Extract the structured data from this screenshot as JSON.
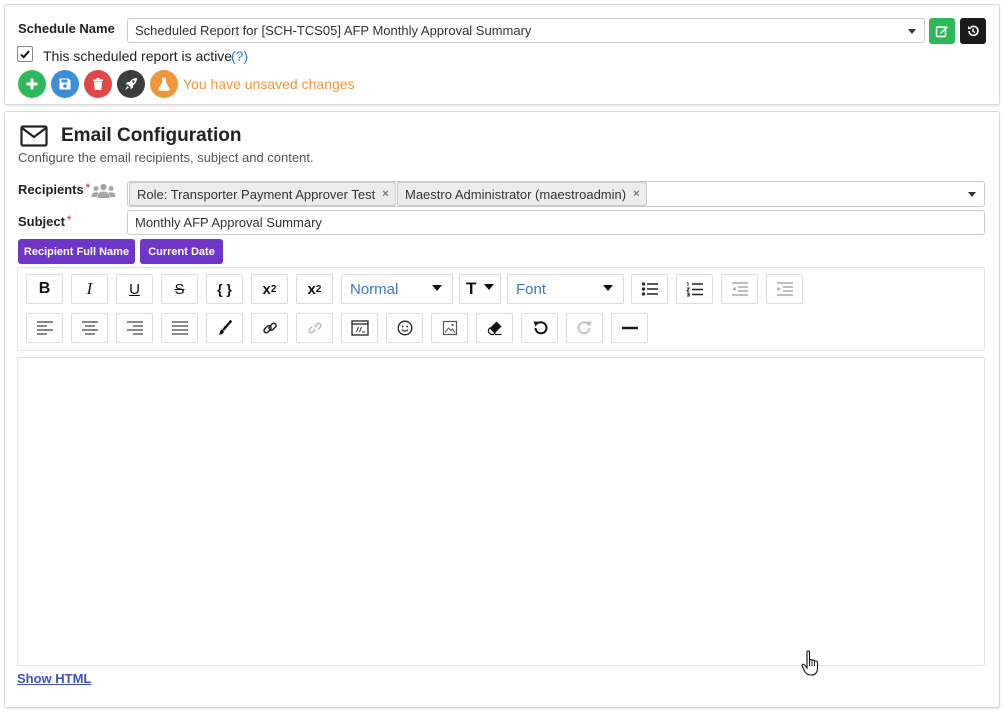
{
  "schedule": {
    "name_label": "Schedule Name",
    "name_value": "Scheduled Report for [SCH-TCS05] AFP Monthly Approval Summary",
    "active_label": "This scheduled report is active",
    "active_help": "(?)",
    "active_checked": true,
    "unsaved_message": "You have unsaved changes"
  },
  "email": {
    "title": "Email Configuration",
    "description": "Configure the email recipients, subject and content.",
    "recipients_label": "Recipients",
    "required_mark": "*",
    "recipients": [
      {
        "label": "Role: Transporter Payment Approver Test",
        "remove": "×"
      },
      {
        "label": "Maestro Administrator (maestroadmin)",
        "remove": "×"
      }
    ],
    "subject_label": "Subject",
    "subject_value": "Monthly AFP Approval Summary",
    "placeholders": [
      "Recipient Full Name",
      "Current Date"
    ],
    "show_html_link": "Show HTML"
  },
  "toolbar": {
    "bold": "B",
    "italic": "I",
    "underline": "U",
    "strikethrough": "S",
    "code": "{ }",
    "superscript_base": "x",
    "superscript_exp": "2",
    "subscript_base": "x",
    "subscript_exp": "2",
    "paragraph_format": "Normal",
    "font_size_icon": "T",
    "font_family": "Font"
  },
  "colors": {
    "green": "#2fb85a",
    "blue": "#3a8fd6",
    "red": "#e04848",
    "dark": "#3c3c3c",
    "orange": "#f0953a",
    "purple": "#6f35c9",
    "warning_text": "#f0953a"
  },
  "icons": [
    "edit-icon",
    "history-icon",
    "plus-icon",
    "save-icon",
    "trash-icon",
    "rocket-icon",
    "flask-icon",
    "envelope-icon",
    "users-icon"
  ]
}
